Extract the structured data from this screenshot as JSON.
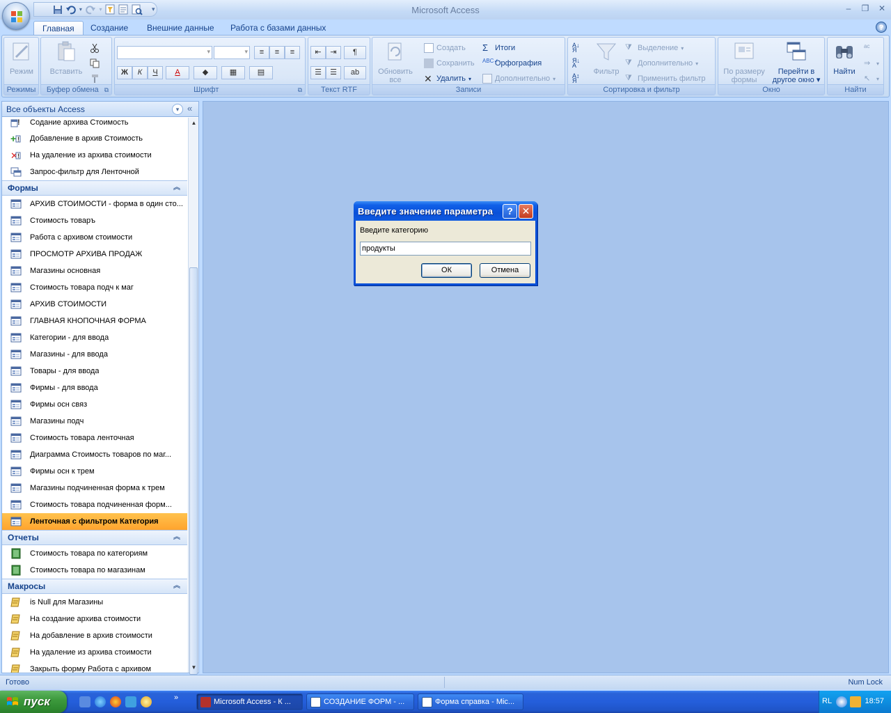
{
  "app_title": "Microsoft Access",
  "tabs": [
    "Главная",
    "Создание",
    "Внешние данные",
    "Работа с базами данных"
  ],
  "ribbon": {
    "groups": {
      "views": "Режимы",
      "clipboard": "Буфер обмена",
      "font": "Шрифт",
      "rtf": "Текст RTF",
      "records": "Записи",
      "sort_filter": "Сортировка и фильтр",
      "window": "Окно",
      "find": "Найти"
    },
    "mode_btn": "Режим",
    "paste_btn": "Вставить",
    "refresh_btn_1": "Обновить",
    "refresh_btn_2": "все",
    "new_btn": "Создать",
    "save_btn": "Сохранить",
    "delete_btn": "Удалить",
    "totals_btn": "Итоги",
    "spelling_btn": "Орфография",
    "more_btn": "Дополнительно",
    "filter_btn": "Фильтр",
    "selection_btn": "Выделение",
    "advanced_btn": "Дополнительно",
    "apply_filter_btn": "Применить фильтр",
    "fit_form_1": "По размеру",
    "fit_form_2": "формы",
    "switch_window_1": "Перейти в",
    "switch_window_2": "другое окно",
    "find_btn": "Найти",
    "bold": "Ж",
    "italic": "К",
    "underline": "Ч",
    "font_color": "A"
  },
  "nav": {
    "title": "Все объекты Access",
    "queries": [
      "Содание архива Стоимость",
      "Добавление в архив Стоимость",
      "На удаление из архива стоимости",
      "Запрос-фильтр для Ленточной"
    ],
    "forms_header": "Формы",
    "forms": [
      "АРХИВ СТОИМОСТИ - форма в один сто...",
      "Стоимость товаръ",
      "Работа с архивом стоимости",
      "ПРОСМОТР АРХИВА ПРОДАЖ",
      "Магазины основная",
      "Стоимость товара подч к маг",
      "АРХИВ СТОИМОСТИ",
      "ГЛАВНАЯ КНОПОЧНАЯ ФОРМА",
      "Категории - для ввода",
      "Магазины - для ввода",
      "Товары - для ввода",
      "Фирмы - для ввода",
      "Фирмы осн связ",
      "Магазины подч",
      "Стоимость товара ленточная",
      "Диаграмма Стоимость товаров по  маг...",
      "Фирмы осн к трем",
      "Магазины подчиненная форма к трем",
      "Стоимость товара подчиненная форм...",
      "Ленточная с фильтром Категория"
    ],
    "reports_header": "Отчеты",
    "reports": [
      "Стоимость товара по категориям",
      "Стоимость товара по магазинам"
    ],
    "macros_header": "Макросы",
    "macros": [
      "is Null для Магазины",
      "На создание архива стоимости",
      "На добавление в архив стоимости",
      "На удаление из архива стоимости",
      "Закрыть форму Работа с архивом"
    ]
  },
  "dialog": {
    "title": "Введите значение параметра",
    "prompt": "Введите категорию",
    "value": "продукты",
    "ok": "ОК",
    "cancel": "Отмена"
  },
  "status": {
    "left": "Готово",
    "right": "Num Lock"
  },
  "taskbar": {
    "start": "пуск",
    "more": "»",
    "tasks": [
      "Microsoft Access - К ...",
      "СОЗДАНИЕ ФОРМ - ...",
      "Форма справка - Mic..."
    ],
    "lang": "RL",
    "clock": "18:57"
  },
  "colors": {
    "selected_item": "#ffa42e",
    "workspace": "#a7c4ec",
    "dialog_title": "#0a50d8",
    "taskbar": "#245edb",
    "start_button": "#3d9a3d"
  }
}
